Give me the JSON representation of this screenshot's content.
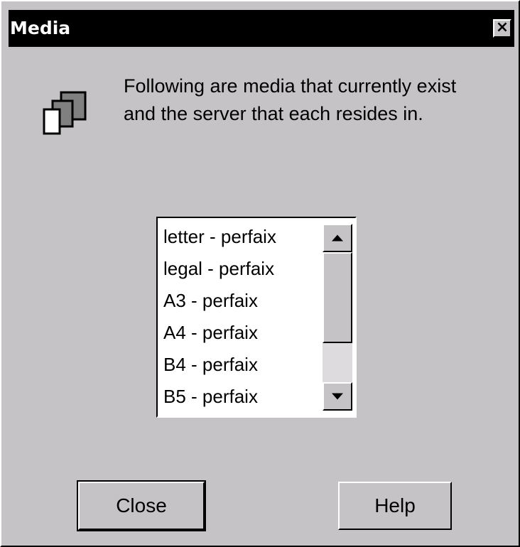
{
  "window": {
    "title": "Media",
    "close_glyph": "×"
  },
  "icon": "media-pages-icon",
  "message": "Following are media that currently exist and the server that each resides in.",
  "media_list": {
    "items": [
      "letter - perfaix",
      "legal - perfaix",
      "A3 - perfaix",
      "A4 - perfaix",
      "B4 - perfaix",
      "B5 - perfaix"
    ]
  },
  "buttons": {
    "close_label": "Close",
    "help_label": "Help"
  },
  "colors": {
    "dialog_background": "#c6c3c6",
    "title_bar": "#000000",
    "list_background": "#ffffff"
  }
}
